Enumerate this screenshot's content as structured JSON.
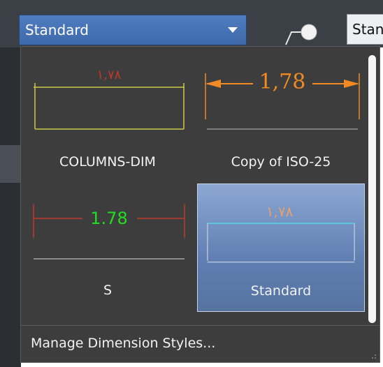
{
  "toolbar": {
    "dimension_style_combo": {
      "selected": "Standard"
    },
    "multileader_style_combo": {
      "selected": "Stan"
    }
  },
  "dropdown": {
    "styles": [
      {
        "name": "COLUMNS-DIM",
        "preview_text": "١,٧٨",
        "preview_text_color": "#c0392b",
        "line_color": "#c9c94a",
        "selected": false
      },
      {
        "name": "Copy of ISO-25",
        "preview_text": "1,78",
        "preview_text_color": "#f08a24",
        "line_color": "#f08a24",
        "selected": false
      },
      {
        "name": "S",
        "preview_text": "1.78",
        "preview_text_color": "#22dd22",
        "line_color": "#c0392b",
        "selected": false
      },
      {
        "name": "Standard",
        "preview_text": "١,٧٨",
        "preview_text_color": "#e8a06c",
        "line_color": "#4fd6ea",
        "selected": true
      }
    ],
    "footer": {
      "manage_label": "Manage Dimension Styles..."
    }
  },
  "colors": {
    "toolbar_bg": "#3b3f46",
    "panel_bg": "#3d3d3d",
    "combo_accent": "#4a76b8",
    "selected_tile": "#6f8fc3"
  }
}
